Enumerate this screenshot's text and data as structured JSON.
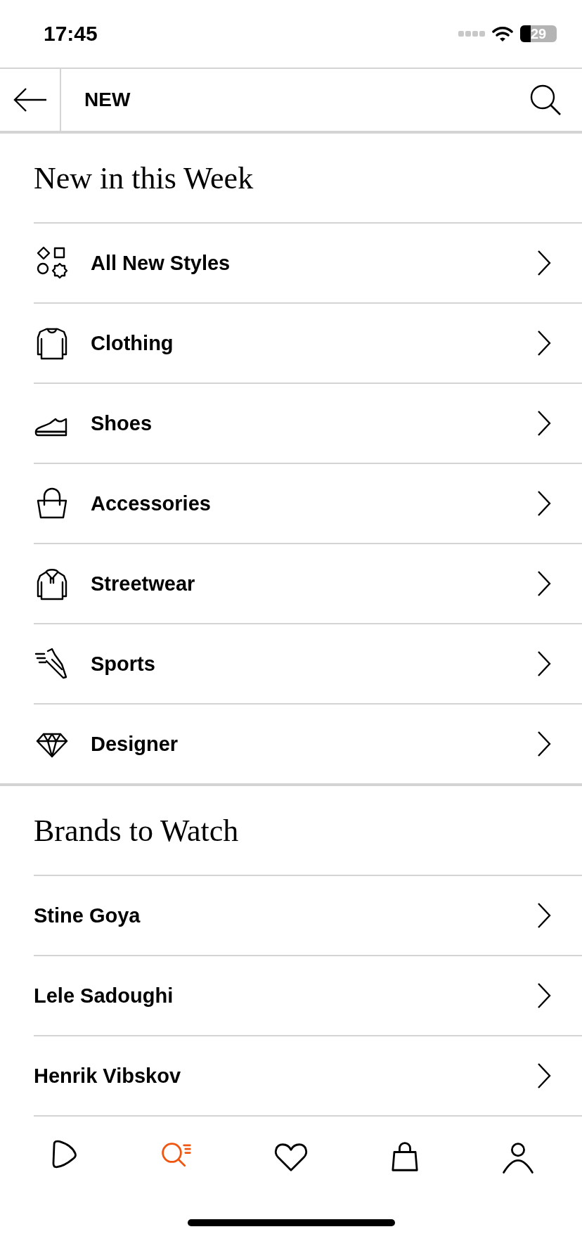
{
  "status_bar": {
    "time": "17:45",
    "battery": "29"
  },
  "header": {
    "title": "NEW"
  },
  "sections": [
    {
      "title": "New in this Week",
      "items": [
        {
          "label": "All New Styles",
          "kind": "shapes"
        },
        {
          "label": "Clothing",
          "kind": "sweater"
        },
        {
          "label": "Shoes",
          "kind": "sneaker"
        },
        {
          "label": "Accessories",
          "kind": "handbag"
        },
        {
          "label": "Streetwear",
          "kind": "hoodie"
        },
        {
          "label": "Sports",
          "kind": "running-shoe"
        },
        {
          "label": "Designer",
          "kind": "diamond"
        }
      ]
    },
    {
      "title": "Brands to Watch",
      "items": [
        {
          "label": "Stine Goya"
        },
        {
          "label": "Lele Sadoughi"
        },
        {
          "label": "Henrik Vibskov"
        }
      ]
    }
  ],
  "tab_bar": [
    {
      "kind": "play",
      "selected": false
    },
    {
      "kind": "search",
      "selected": true
    },
    {
      "kind": "heart",
      "selected": false
    },
    {
      "kind": "bag",
      "selected": false
    },
    {
      "kind": "account",
      "selected": false
    }
  ]
}
